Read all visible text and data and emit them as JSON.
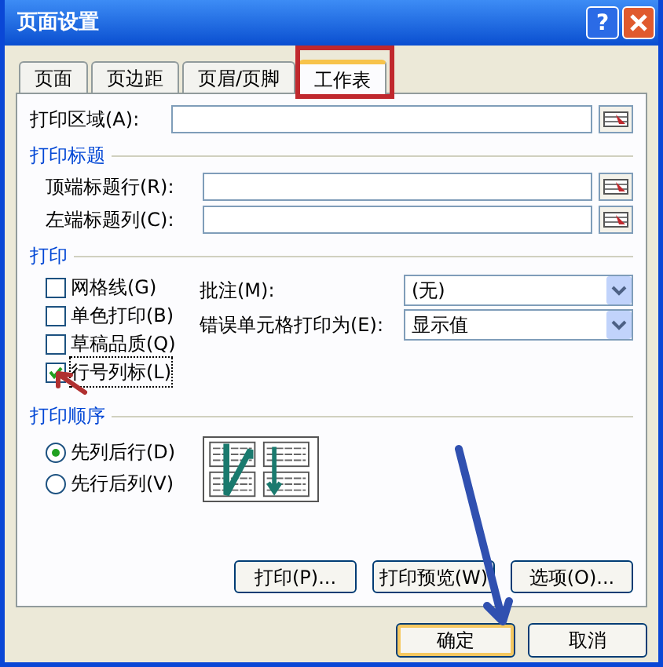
{
  "window": {
    "title": "页面设置",
    "help": "?"
  },
  "tabs": [
    {
      "label": "页面",
      "selected": false
    },
    {
      "label": "页边距",
      "selected": false
    },
    {
      "label": "页眉/页脚",
      "selected": false
    },
    {
      "label": "工作表",
      "selected": true
    }
  ],
  "print_area": {
    "label": "打印区域(A):"
  },
  "print_titles": {
    "heading": "打印标题",
    "fields": [
      {
        "label": "顶端标题行(R):"
      },
      {
        "label": "左端标题列(C):"
      }
    ]
  },
  "print": {
    "heading": "打印",
    "checkboxes": [
      {
        "label": "网格线(G)",
        "checked": false
      },
      {
        "label": "单色打印(B)",
        "checked": false
      },
      {
        "label": "草稿品质(Q)",
        "checked": false
      },
      {
        "label": "行号列标(L)",
        "checked": true
      }
    ],
    "dropdowns": [
      {
        "label": "批注(M):",
        "value": "(无)"
      },
      {
        "label": "错误单元格打印为(E):",
        "value": "显示值"
      }
    ]
  },
  "page_order": {
    "heading": "打印顺序",
    "options": [
      {
        "label": "先列后行(D)",
        "selected": true
      },
      {
        "label": "先行后列(V)",
        "selected": false
      }
    ]
  },
  "panel_buttons": [
    "打印(P)...",
    "打印预览(W)",
    "选项(O)..."
  ],
  "footer_buttons": [
    "确定",
    "取消"
  ],
  "annotations": [
    {
      "kind": "frame",
      "color": "#c0282d"
    },
    {
      "kind": "arrow",
      "color": "#b03030"
    },
    {
      "kind": "arrow",
      "color": "#3050b0"
    }
  ]
}
